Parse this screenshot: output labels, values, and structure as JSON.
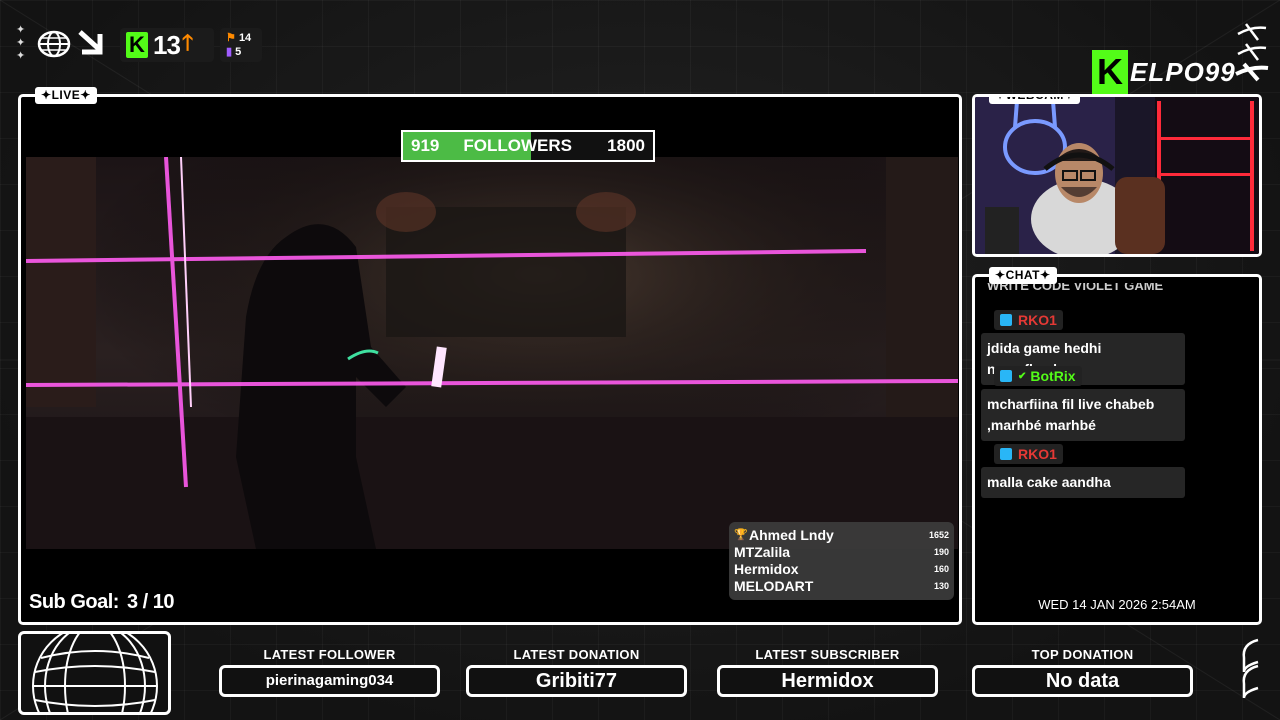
{
  "header": {
    "kick_count": "13",
    "stat_top": "14",
    "stat_bottom": "5"
  },
  "brand": {
    "logo_letter": "K",
    "name": "ELPO99"
  },
  "live": {
    "tag": "LIVE",
    "followers_goal": {
      "current": "919",
      "label": "FOLLOWERS",
      "goal": "1800",
      "progress": 0.51
    },
    "sub_goal": {
      "label": "Sub Goal:",
      "value": "3 / 10"
    },
    "leaderboard": [
      {
        "name": "Ahmed Lndy",
        "score": "1652"
      },
      {
        "name": "MTZalila",
        "score": "190"
      },
      {
        "name": "Hermidox",
        "score": "160"
      },
      {
        "name": "MELODART",
        "score": "130"
      }
    ]
  },
  "webcam": {
    "tag": "WEBCAM"
  },
  "chat": {
    "tag": "CHAT",
    "truncated_top": "WRITE CODE VIOLET GAME",
    "messages": [
      {
        "user": "RKO1",
        "user_color": "#e53935",
        "badge": "#29b6f6",
        "text": "jdida game hedhi naarefhech"
      },
      {
        "user": "BotRix",
        "user_color": "#53fc18",
        "badge": "#29b6f6",
        "text": "mcharfiina fil live chabeb ,marhbé marhbé"
      },
      {
        "user": "RKO1",
        "user_color": "#e53935",
        "badge": "#29b6f6",
        "text": "malla cake aandha"
      }
    ],
    "timestamp": "WED 14 JAN 2026 2:54AM"
  },
  "bottom_stats": [
    {
      "label": "LATEST FOLLOWER",
      "value": "pierinagaming034"
    },
    {
      "label": "LATEST DONATION",
      "value": "Gribiti77"
    },
    {
      "label": "LATEST SUBSCRIBER",
      "value": "Hermidox"
    },
    {
      "label": "TOP DONATION",
      "value": "No data"
    }
  ],
  "colors": {
    "kick_green": "#53fc18",
    "followers_fill": "#4cbb45",
    "arrow_orange": "#ff8a00",
    "neon_pink": "#ff5cf0"
  }
}
